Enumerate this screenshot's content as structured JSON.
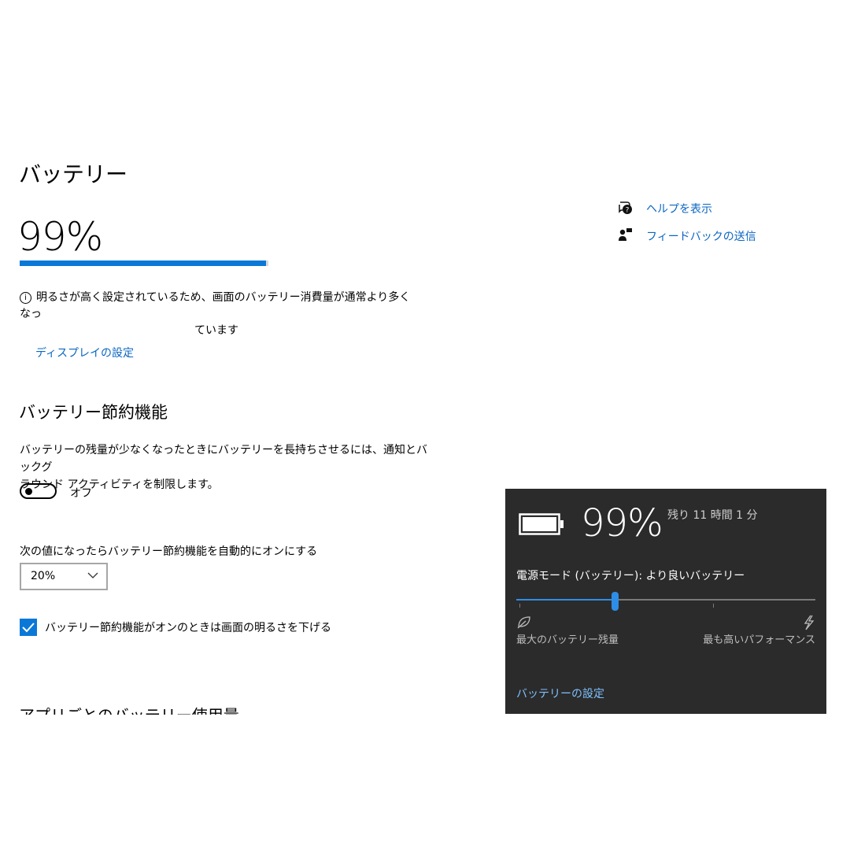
{
  "page": {
    "title": "バッテリー",
    "percent_label": "99%",
    "charge_fraction": 0.99
  },
  "info": {
    "icon": "info-icon",
    "line1": "明るさが高く設定されているため、画面のバッテリー消費量が通常より多くなっ",
    "line2": "ています",
    "display_link": "ディスプレイの設定"
  },
  "saver": {
    "heading": "バッテリー節約機能",
    "description_line1": "バッテリーの残量が少なくなったときにバッテリーを長持ちさせるには、通知とバックグ",
    "description_line2": "ラウンド アクティビティを制限します。",
    "toggle_label": "オフ",
    "toggle_on": false,
    "auto_label": "次の値になったらバッテリー節約機能を自動的にオンにする",
    "threshold": "20%",
    "brightness_label": "バッテリー節約機能がオンのときは画面の明るさを下げる",
    "brightness_checked": true
  },
  "usage": {
    "heading_cut": "アプリごとのバッテリー使用量"
  },
  "side": {
    "help_label": "ヘルプを表示",
    "help_icon": "chat-help-icon",
    "feedback_label": "フィードバックの送信",
    "feedback_icon": "feedback-person-icon"
  },
  "flyout": {
    "percent": "99%",
    "remaining": "残り 11 時間 1 分",
    "mode_label": "電源モード (バッテリー): より良いバッテリー",
    "slider_fraction": 0.33,
    "left_label": "最大のバッテリー残量",
    "left_icon": "leaf-icon",
    "right_label": "最も高いパフォーマンス",
    "right_icon": "lightning-icon",
    "settings_link": "バッテリーの設定"
  },
  "colors": {
    "accent": "#0a78d7",
    "link": "#0a66c2",
    "flyout_bg": "#2b2b2b",
    "flyout_accent": "#2e8de6",
    "flyout_link": "#7fc1ff"
  }
}
